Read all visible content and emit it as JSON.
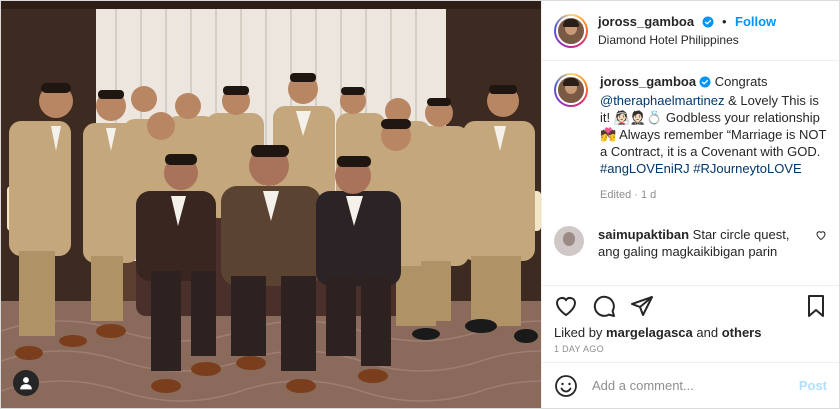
{
  "header": {
    "username": "joross_gamboa",
    "separator": "•",
    "follow_label": "Follow",
    "location": "Diamond Hotel Philippines"
  },
  "caption": {
    "username": "joross_gamboa",
    "text_1": " Congrats ",
    "mention": "@theraphaelmartinez",
    "text_2": " & Lovely This is it! 👰🏻🤵🏻💍 Godbless your relationship 💏 Always remember “Marriage is NOT a Contract, it is a Covenant with GOD. ",
    "hashtag_1": "#angLOVEniRJ",
    "hashtag_2": "#RJourneytoLOVE",
    "edited": "Edited",
    "separator": "·",
    "age": "1 d"
  },
  "comments": [
    {
      "username": "saimupaktiban",
      "text": "Star circle quest, ang galing magkaikibigan parin"
    }
  ],
  "likes": {
    "prefix": "Liked by",
    "user": "margelagasca",
    "and": "and",
    "others": "others"
  },
  "date": "1 DAY AGO",
  "add_comment": {
    "placeholder": "Add a comment...",
    "post_label": "Post"
  },
  "icons": [
    "tag-user-icon",
    "verified-icon",
    "heart-icon",
    "comment-icon",
    "share-icon",
    "bookmark-icon",
    "emoji-icon"
  ],
  "colors": {
    "accent": "#0095f6",
    "link": "#00376b",
    "muted": "#8e8e8e",
    "post_disabled": "#b2dffc"
  }
}
